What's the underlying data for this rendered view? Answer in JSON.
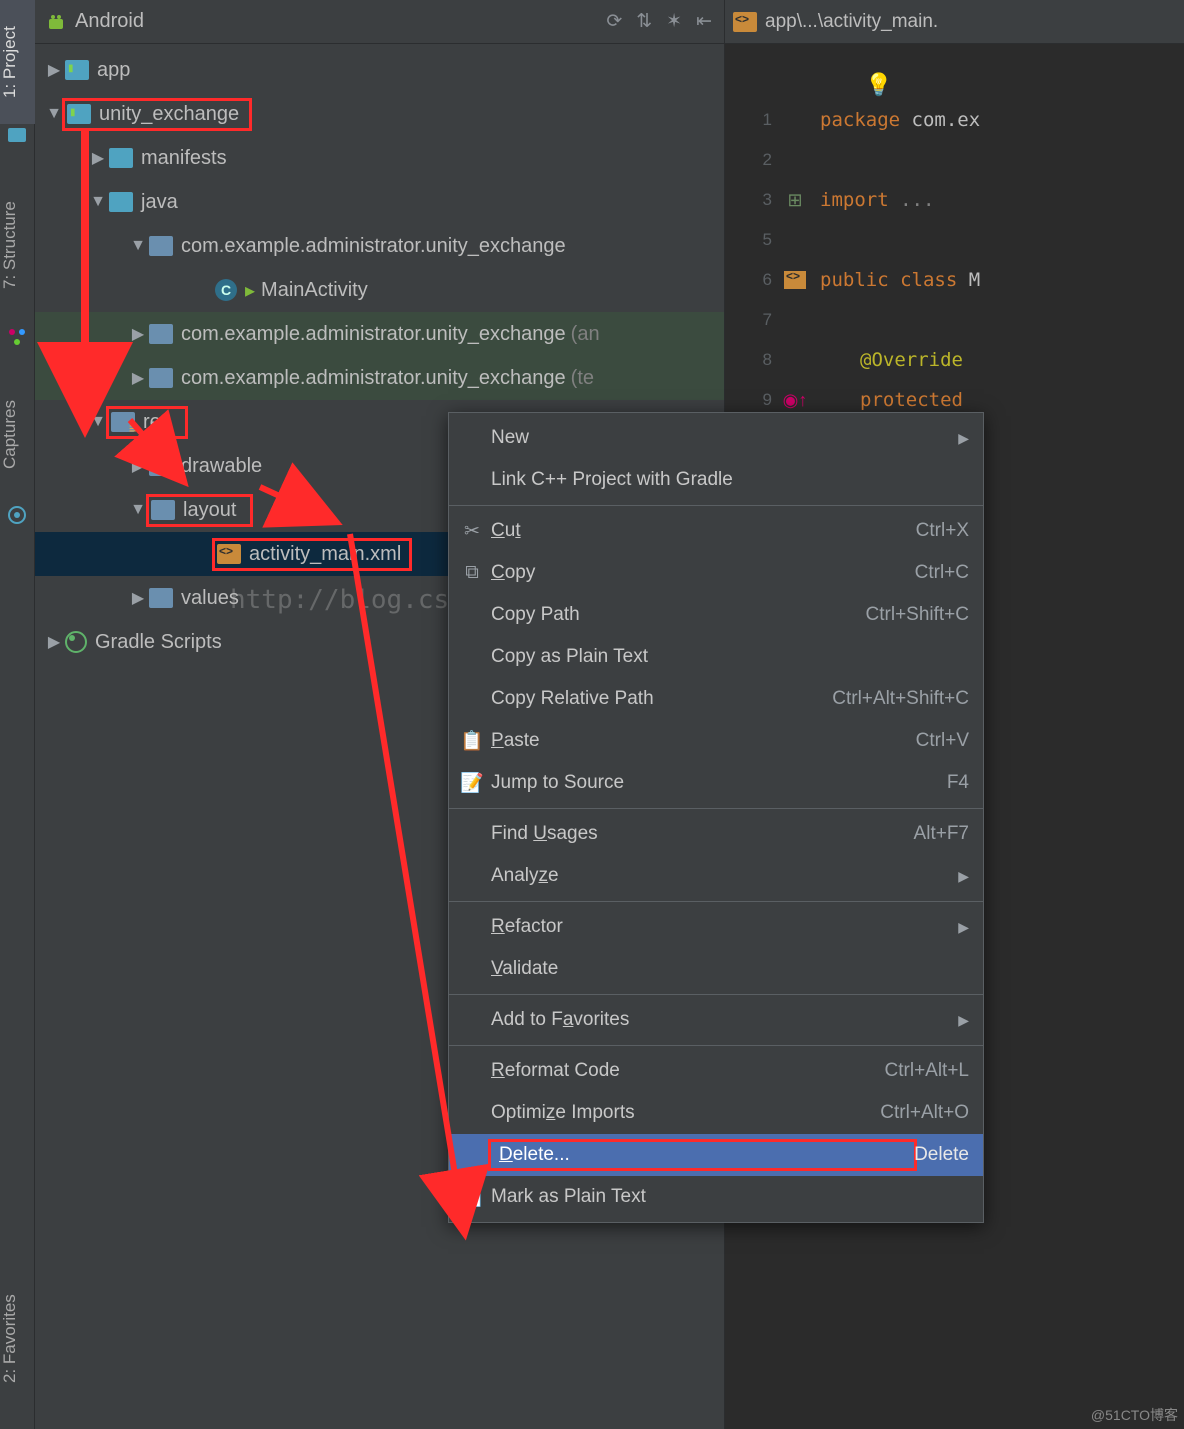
{
  "leftStrip": {
    "project": "1: Project",
    "structure": "7: Structure",
    "captures": "Captures",
    "favorites": "2: Favorites"
  },
  "panel": {
    "title": "Android",
    "tools": {
      "t1": "⟳",
      "t2": "⇅",
      "t3": "✶",
      "t4": "⇤"
    }
  },
  "tree": {
    "app": "app",
    "unity": "unity_exchange",
    "manifests": "manifests",
    "java": "java",
    "pkg1": "com.example.administrator.unity_exchange",
    "mainAct": "MainActivity",
    "pkg2": "com.example.administrator.unity_exchange",
    "pkg2s": "(an",
    "pkg3": "com.example.administrator.unity_exchange",
    "pkg3s": "(te",
    "res": "res",
    "drawable": "drawable",
    "layout": "layout",
    "actmain": "activity_main.xml",
    "values": "values",
    "gradle": "Gradle Scripts"
  },
  "tab": {
    "name": "app\\...\\activity_main."
  },
  "gutter": [
    "1",
    "2",
    "3",
    "5",
    "6",
    "7",
    "8",
    "9"
  ],
  "code": {
    "l1a": "package ",
    "l1b": "com.ex",
    "l3a": "import ",
    "l3b": "...",
    "l6a": "public class ",
    "l6b": "M",
    "l8": "@Override",
    "l9": "protected"
  },
  "menu": {
    "new": "New",
    "linkcpp": "Link C++ Project with Gradle",
    "cut": "Cut",
    "cut_s": "Ctrl+X",
    "copy": "Copy",
    "copy_s": "Ctrl+C",
    "copypath": "Copy Path",
    "copypath_s": "Ctrl+Shift+C",
    "copyplain": "Copy as Plain Text",
    "copyrel": "Copy Relative Path",
    "copyrel_s": "Ctrl+Alt+Shift+C",
    "paste": "Paste",
    "paste_s": "Ctrl+V",
    "jump": "Jump to Source",
    "jump_s": "F4",
    "findu": "Find Usages",
    "findu_s": "Alt+F7",
    "analyze": "Analyze",
    "refactor": "Refactor",
    "validate": "Validate",
    "addfav": "Add to Favorites",
    "reformat": "Reformat Code",
    "reformat_s": "Ctrl+Alt+L",
    "optimp": "Optimize Imports",
    "optimp_s": "Ctrl+Alt+O",
    "delete": "Delete...",
    "delete_s": "Delete",
    "markplain": "Mark as Plain Text"
  },
  "watermark": "http://blog.csdn.net/BuladeMian",
  "credit": "@51CTO博客"
}
